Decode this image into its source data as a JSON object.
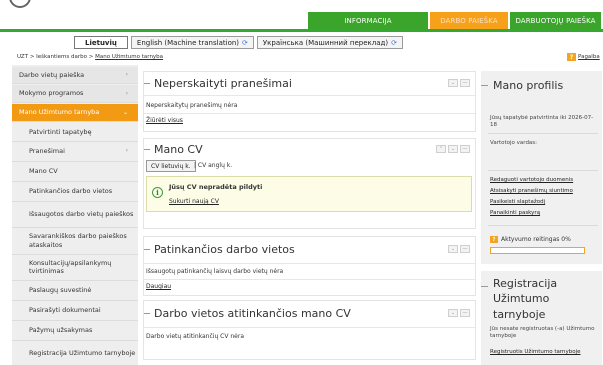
{
  "top_tabs": [
    "INFORMACIJA",
    "DARBO PAIEŠKA",
    "DARBUOTOJŲ PAIEŠKA"
  ],
  "languages": [
    {
      "label": "Lietuvių",
      "active": true
    },
    {
      "label": "English (Machine translation)",
      "active": false
    },
    {
      "label": "Українська (Машинний переклад)",
      "active": false
    }
  ],
  "breadcrumb": {
    "root": "UZT",
    "sep": ">",
    "level1": "Ieškantiems darbo",
    "current": "Mano Užimtumo tarnyba"
  },
  "help": {
    "icon": "?",
    "label": "Pagalba"
  },
  "sidebar": {
    "items": [
      {
        "label": "Darbo vietų paieška",
        "arrow": "›"
      },
      {
        "label": "Mokymo programos",
        "arrow": "›"
      },
      {
        "label": "Mano Užimtumo tarnyba",
        "arrow": "⌄"
      },
      {
        "label": "Patvirtinti tapatybę"
      },
      {
        "label": "Pranešimai",
        "arrow": "›"
      },
      {
        "label": "Mano CV"
      },
      {
        "label": "Patinkančios darbo vietos"
      },
      {
        "label": "Išsaugotos darbo vietų paieškos"
      },
      {
        "label": "Savarankiškos darbo paieškos ataskaitos"
      },
      {
        "label": "Konsultacijų/apsilankymų tvirtinimas"
      },
      {
        "label": "Paslaugų suvestinė"
      },
      {
        "label": "Pasirašyti dokumentai"
      },
      {
        "label": "Pažymų užsakymas"
      },
      {
        "label": "Registracija Užimtumo tarnyboje"
      }
    ]
  },
  "messages_panel": {
    "title": "Neperskaityti pranešimai",
    "empty": "Neperskaitytų pranešimų nėra",
    "link": "Žiūrėti visus"
  },
  "cv_panel": {
    "title": "Mano CV",
    "btn_lt": "CV lietuvių k.",
    "alt_text": "| CV anglų k.",
    "alert_icon": "i",
    "alert_title": "Jūsų CV nepradėta pildyti",
    "alert_link": "Sukurti naują CV"
  },
  "liked_panel": {
    "title": "Patinkančios darbo vietos",
    "empty": "Išsaugotų patinkančių laisvų darbo vietų nėra",
    "link": "Daugiau"
  },
  "matching_panel": {
    "title": "Darbo vietos atitinkančios mano CV",
    "empty": "Darbo vietų atitinkančių CV nėra"
  },
  "profile": {
    "title": "Mano profilis",
    "identity_text": "Jūsų tapatybė patvirtinta iki 2026-07-18",
    "username_label": "Vartotojo vardas:",
    "links": [
      "Redaguoti vartotojo duomenis",
      "Atsisakyti pranešimų siuntimo",
      "Pasikeisti slaptažodį",
      "Panaikinti paskyrą"
    ],
    "rating_icon": "?",
    "rating_label": "Aktyvumo reitingas 0%",
    "rating_value": 0
  },
  "registration": {
    "title": "Registracija Užimtumo tarnyboje",
    "text": "Jūs nesate registruotas (-a) Užimtumo tarnyboje",
    "link": "Registruotis Užimtumo tarnyboje"
  },
  "controls": {
    "min": "⌃",
    "close": "⌄",
    "x": "—"
  },
  "colors": {
    "green": "#3aa52a",
    "orange": "#f7a01a"
  }
}
